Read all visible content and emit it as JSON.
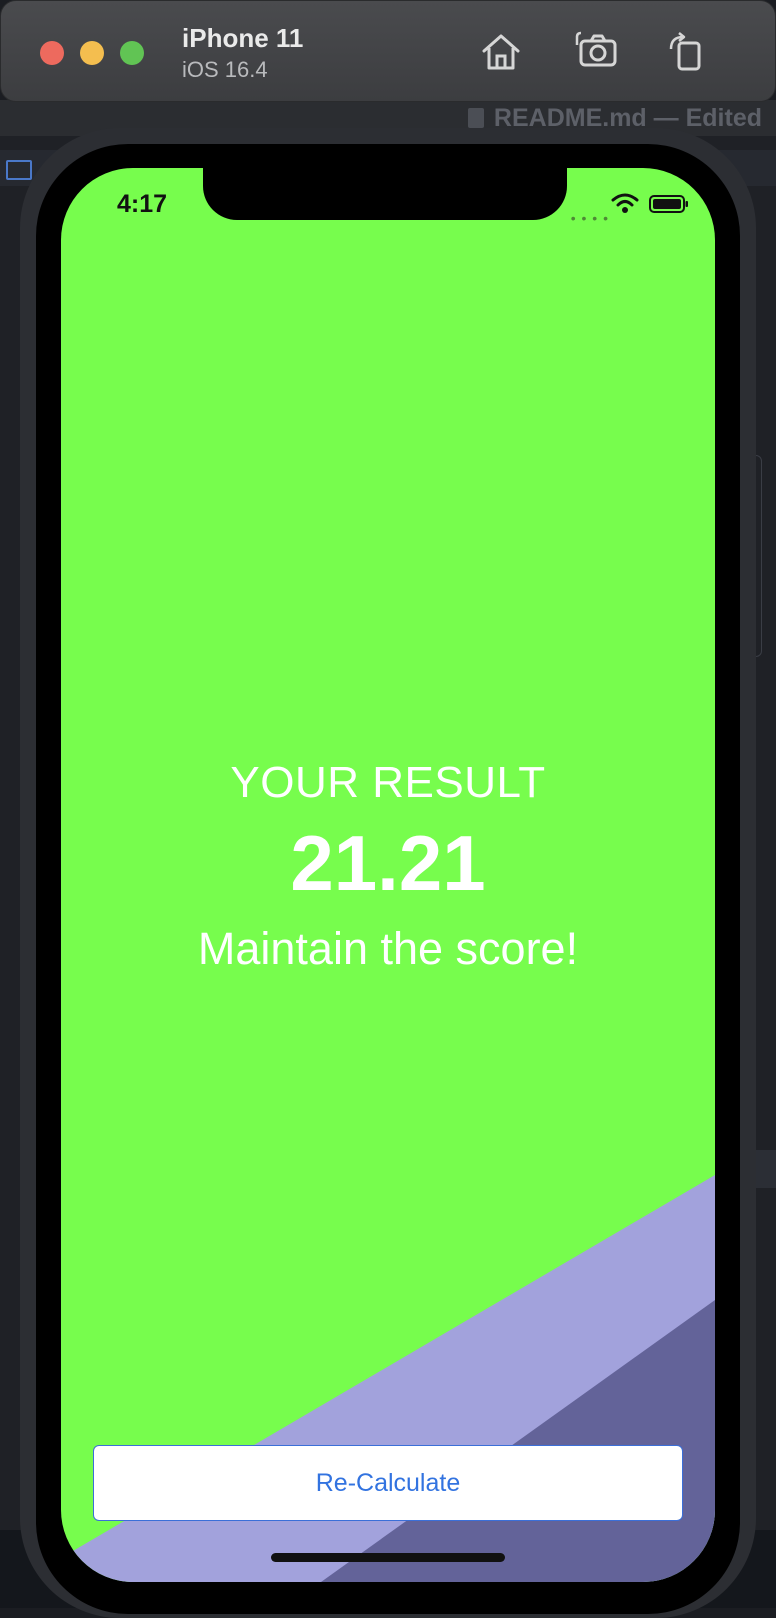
{
  "simulator": {
    "device_name": "iPhone 11",
    "os_version": "iOS 16.4",
    "toolbar_icons": [
      "home-icon",
      "screenshot-icon",
      "rotate-icon"
    ]
  },
  "background_editor": {
    "document_title": "README.md — Edited"
  },
  "status_bar": {
    "time": "4:17"
  },
  "result": {
    "title": "YOUR RESULT",
    "value": "21.21",
    "advice": "Maintain the score!"
  },
  "actions": {
    "recalculate_label": "Re-Calculate"
  },
  "colors": {
    "screen_background": "#77fd4d",
    "stripe_light": "#a2a2dc",
    "stripe_dark": "#636399",
    "button_text": "#3273e0"
  }
}
